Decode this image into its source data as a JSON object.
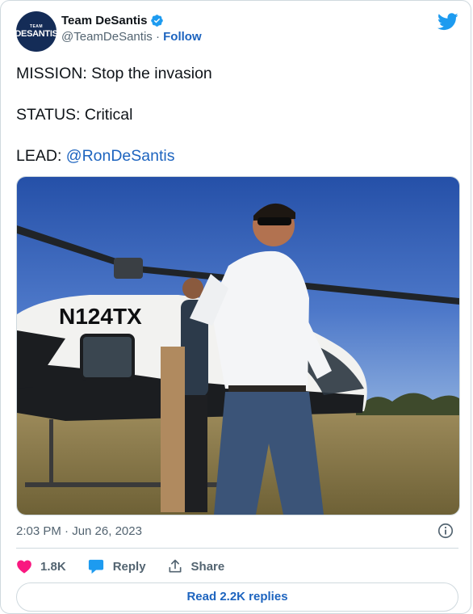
{
  "author": {
    "display_name": "Team DeSantis",
    "handle": "@TeamDeSantis",
    "separator": "·",
    "follow_label": "Follow",
    "avatar_top": "TEAM",
    "avatar_main": "DESANTIS"
  },
  "tweet": {
    "line1": "MISSION: Stop the invasion",
    "line2": "STATUS: Critical",
    "line3_prefix": "LEAD: ",
    "line3_mention": "@RonDeSantis"
  },
  "photo": {
    "tail_number": "N124TX"
  },
  "meta": {
    "timestamp": "2:03 PM · Jun 26, 2023"
  },
  "actions": {
    "likes": "1.8K",
    "reply_label": "Reply",
    "share_label": "Share"
  },
  "read_replies": "Read 2.2K replies",
  "colors": {
    "link": "#1d64bf",
    "like": "#f91880",
    "reply": "#1d9bf0",
    "text": "#0f1419",
    "secondary": "#536471",
    "border": "#cfd9de",
    "avatar_bg": "#142c57"
  }
}
